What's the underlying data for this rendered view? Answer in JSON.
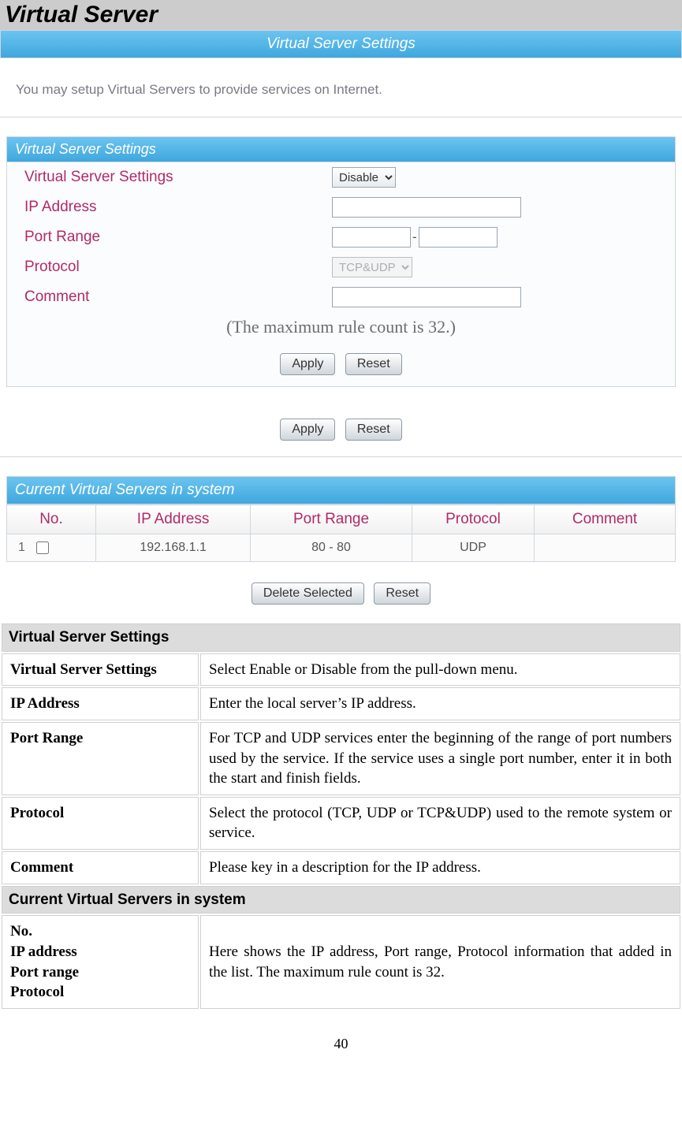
{
  "page": {
    "title": "Virtual Server",
    "panel_title": "Virtual Server Settings",
    "subtext": "You may setup Virtual Servers to provide services on Internet.",
    "page_number": "40"
  },
  "form": {
    "section_head": "Virtual Server Settings",
    "rows": {
      "vss_label": "Virtual Server Settings",
      "vss_value": "Disable",
      "ip_label": "IP Address",
      "ip_value": "",
      "port_label": "Port Range",
      "port_from": "",
      "port_to": "",
      "protocol_label": "Protocol",
      "protocol_value": "TCP&UDP",
      "comment_label": "Comment",
      "comment_value": ""
    },
    "note": "(The maximum rule count is 32.)",
    "buttons": {
      "apply": "Apply",
      "reset": "Reset"
    }
  },
  "current": {
    "title": "Current Virtual Servers in system",
    "columns": {
      "no": "No.",
      "ip": "IP Address",
      "port": "Port Range",
      "proto": "Protocol",
      "comment": "Comment"
    },
    "rows": [
      {
        "no": "1",
        "ip": "192.168.1.1",
        "port": "80 - 80",
        "proto": "UDP",
        "comment": ""
      }
    ],
    "buttons": {
      "delete": "Delete Selected",
      "reset": "Reset"
    }
  },
  "doc": {
    "section1": "Virtual Server Settings",
    "r1k": "Virtual Server Settings",
    "r1v": "Select Enable or Disable from the pull-down menu.",
    "r2k": "IP Address",
    "r2v": "Enter the local server’s IP address.",
    "r3k": "Port Range",
    "r3v": "For TCP and UDP services enter the beginning of the range of port numbers used by the service. If the service uses a single port number, enter it in both the start and finish fields.",
    "r4k": "Protocol",
    "r4v": "Select the protocol (TCP, UDP or TCP&UDP) used to the remote system or service.",
    "r5k": "Comment",
    "r5v": "Please key in a description for the IP address.",
    "section2": "Current Virtual Servers in system",
    "r6k": "No.\nIP address\nPort range\nProtocol",
    "r6v": "Here shows the IP address, Port range, Protocol information that added in the list. The maximum rule count is 32."
  }
}
